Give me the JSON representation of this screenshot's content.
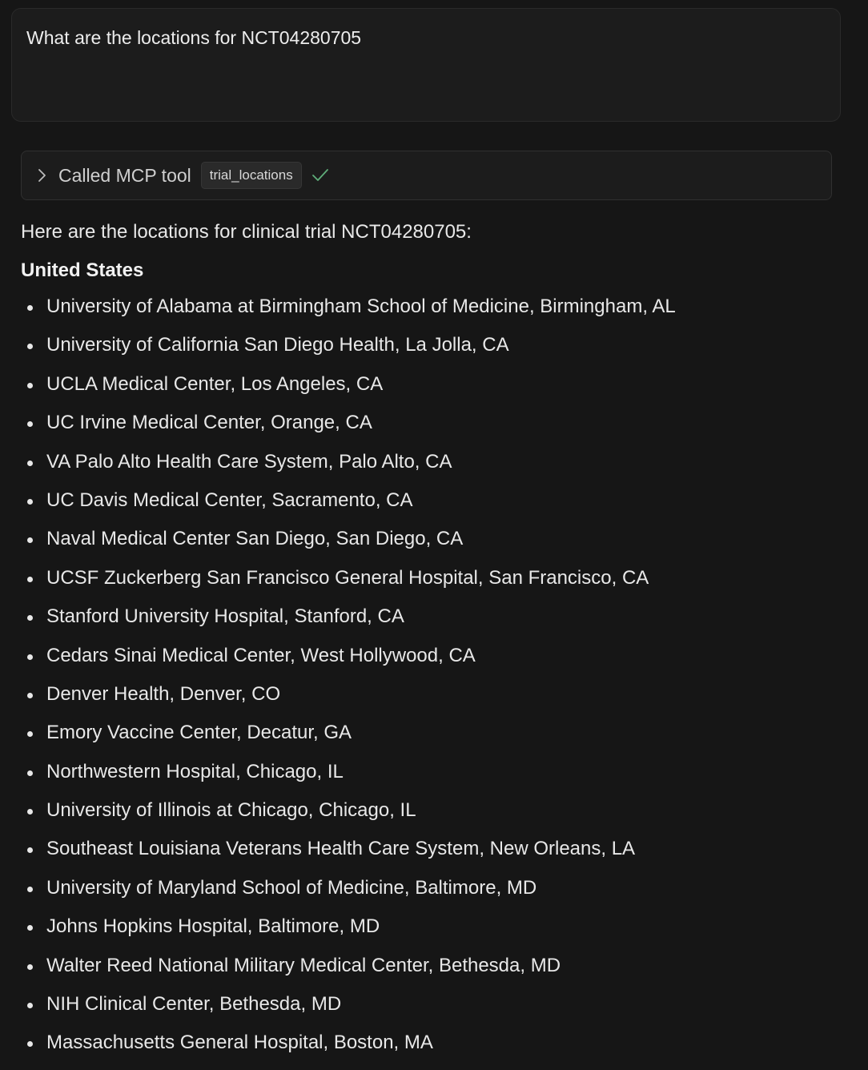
{
  "prompt": {
    "text": "What are the locations for NCT04280705"
  },
  "tool_call": {
    "label": "Called MCP tool",
    "tool_name": "trial_locations",
    "status_icon": "check-icon",
    "expand_icon": "chevron-right-icon"
  },
  "response": {
    "intro": "Here are the locations for clinical trial NCT04280705:",
    "country": "United States",
    "locations": [
      "University of Alabama at Birmingham School of Medicine, Birmingham, AL",
      "University of California San Diego Health, La Jolla, CA",
      "UCLA Medical Center, Los Angeles, CA",
      "UC Irvine Medical Center, Orange, CA",
      "VA Palo Alto Health Care System, Palo Alto, CA",
      "UC Davis Medical Center, Sacramento, CA",
      "Naval Medical Center San Diego, San Diego, CA",
      "UCSF Zuckerberg San Francisco General Hospital, San Francisco, CA",
      "Stanford University Hospital, Stanford, CA",
      "Cedars Sinai Medical Center, West Hollywood, CA",
      "Denver Health, Denver, CO",
      "Emory Vaccine Center, Decatur, GA",
      "Northwestern Hospital, Chicago, IL",
      "University of Illinois at Chicago, Chicago, IL",
      "Southeast Louisiana Veterans Health Care System, New Orleans, LA",
      "University of Maryland School of Medicine, Baltimore, MD",
      "Johns Hopkins Hospital, Baltimore, MD",
      "Walter Reed National Military Medical Center, Bethesda, MD",
      "NIH Clinical Center, Bethesda, MD",
      "Massachusetts General Hospital, Boston, MA"
    ]
  },
  "colors": {
    "background": "#161616",
    "panel": "#1c1c1c",
    "text": "#e8e8e8",
    "success": "#5fae7a"
  }
}
